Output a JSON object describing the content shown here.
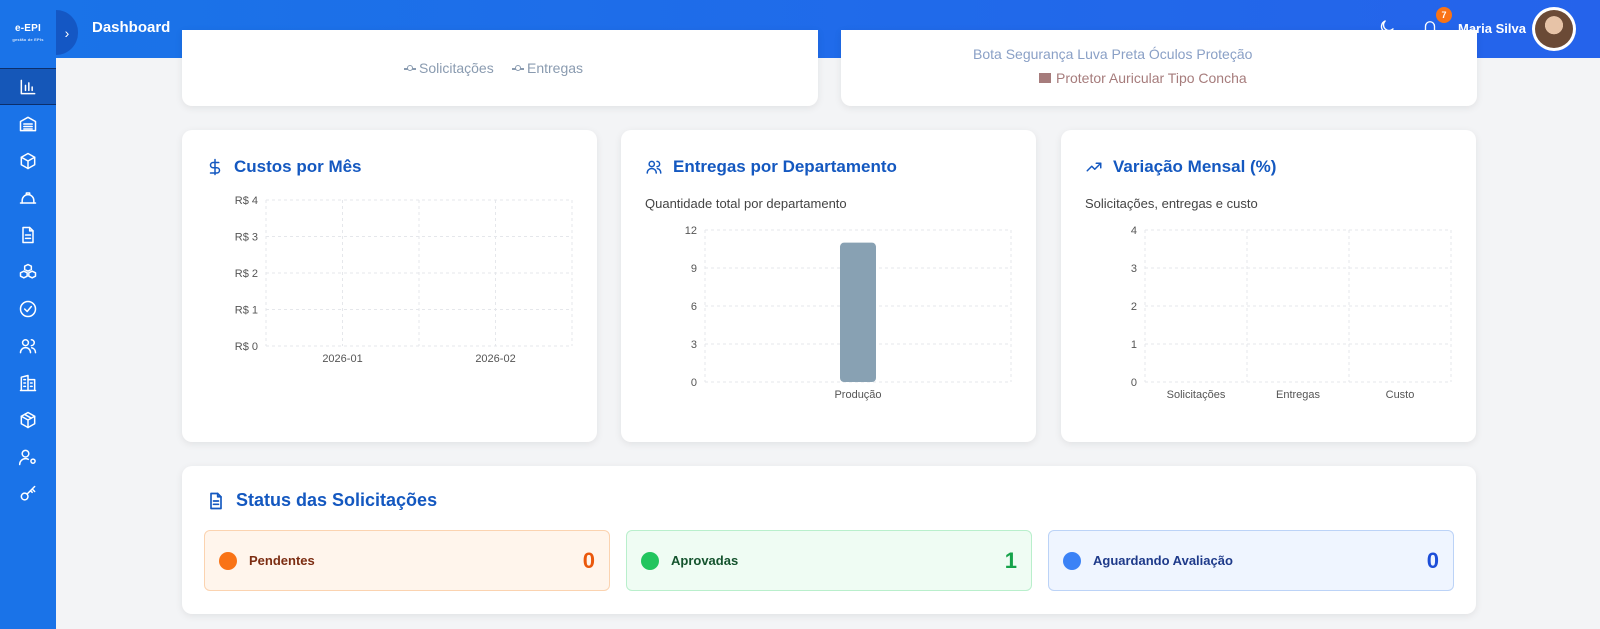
{
  "app": {
    "logo_text": "e-EPI",
    "logo_sub": "gestão de EPIs"
  },
  "header": {
    "title": "Dashboard",
    "notification_count": "7",
    "user_name": "Maria Silva"
  },
  "top_cards": {
    "left_legend": [
      "Solicitações",
      "Entregas"
    ],
    "right_legend_cut": "Bota Segurança   Luva Preta   Óculos Proteção",
    "right_legend_last": "Protetor Auricular Tipo Concha"
  },
  "cards": {
    "costs": {
      "title": "Custos por Mês"
    },
    "deliveries": {
      "title": "Entregas por Departamento",
      "subtitle": "Quantidade total por departamento"
    },
    "variation": {
      "title": "Variação Mensal (%)",
      "subtitle": "Solicitações, entregas e custo"
    }
  },
  "chart_data": [
    {
      "type": "line",
      "title": "Custos por Mês",
      "categories": [
        "2026-01",
        "2026-02"
      ],
      "yticks": [
        "R$ 0",
        "R$ 1",
        "R$ 2",
        "R$ 3",
        "R$ 4"
      ],
      "ylim": [
        0,
        4
      ],
      "series": [],
      "grid": true
    },
    {
      "type": "bar",
      "title": "Entregas por Departamento",
      "categories": [
        "Produção"
      ],
      "values": [
        11
      ],
      "yticks": [
        "0",
        "3",
        "6",
        "9",
        "12"
      ],
      "ylim": [
        0,
        12
      ],
      "color": "#88a1b3",
      "grid": true
    },
    {
      "type": "bar",
      "title": "Variação Mensal (%)",
      "categories": [
        "Solicitações",
        "Entregas",
        "Custo"
      ],
      "values": [
        0,
        0,
        0
      ],
      "yticks": [
        "0",
        "1",
        "2",
        "3",
        "4"
      ],
      "ylim": [
        0,
        4
      ],
      "grid": true
    }
  ],
  "status": {
    "title": "Status das Solicitações",
    "items": [
      {
        "label": "Pendentes",
        "count": "0",
        "color": "#f97316"
      },
      {
        "label": "Aprovadas",
        "count": "1",
        "color": "#22c55e"
      },
      {
        "label": "Aguardando Avaliação",
        "count": "0",
        "color": "#3b82f6"
      }
    ]
  },
  "sidebar": {
    "icons": [
      "bar-chart-icon",
      "warehouse-icon",
      "box-icon",
      "hard-hat-icon",
      "document-icon",
      "boxes-icon",
      "check-circle-icon",
      "users-icon",
      "building-icon",
      "package-icon",
      "user-gear-icon",
      "key-icon"
    ]
  }
}
